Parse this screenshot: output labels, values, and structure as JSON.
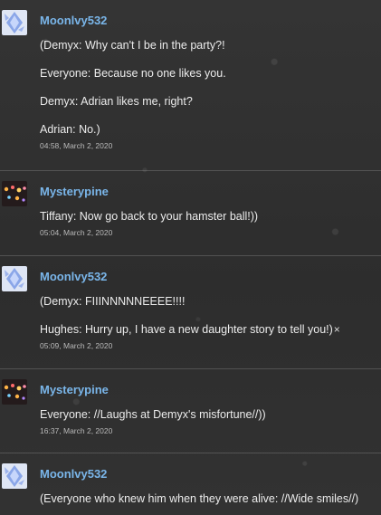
{
  "comments": [
    {
      "user": "Moonlvy532",
      "avatar": "blue-crystal-avatar",
      "lines": [
        "(Demyx: Why can't I be in the party?!",
        "Everyone: Because no one likes you.",
        "Demyx: Adrian likes me, right?",
        "Adrian: No.)"
      ],
      "timestamp": "04:58, March 2, 2020"
    },
    {
      "user": "Mysterypine",
      "avatar": "night-lights-avatar",
      "lines": [
        "Tiffany: Now go back to your hamster ball!))"
      ],
      "timestamp": "05:04, March 2, 2020"
    },
    {
      "user": "Moonlvy532",
      "avatar": "blue-crystal-avatar",
      "lines": [
        "(Demyx: FIIINNNNNEEEE!!!!",
        "Hughes: Hurry up, I have a new daughter story to tell you!)"
      ],
      "timestamp": "05:09, March 2, 2020",
      "close_symbol": "×"
    },
    {
      "user": "Mysterypine",
      "avatar": "night-lights-avatar",
      "lines": [
        "Everyone: //Laughs at Demyx's misfortune//))"
      ],
      "timestamp": "16:37, March 2, 2020"
    },
    {
      "user": "Moonlvy532",
      "avatar": "blue-crystal-avatar",
      "lines": [
        "(Everyone who knew him when they were alive: //Wide smiles//)"
      ]
    }
  ]
}
